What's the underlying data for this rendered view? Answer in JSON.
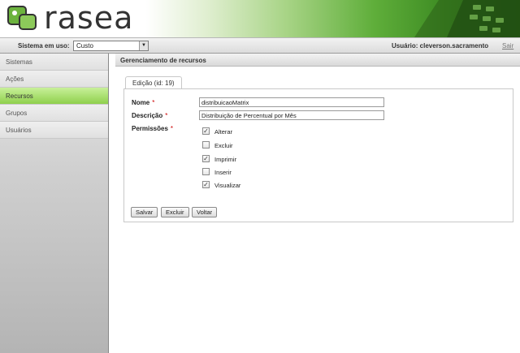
{
  "header": {
    "brand": "rasea"
  },
  "topbar": {
    "system_label": "Sistema em uso:",
    "system_value": "Custo",
    "user_label": "Usuário: cleverson.sacramento",
    "logout_label": "Sair"
  },
  "sidebar": {
    "items": [
      {
        "label": "Sistemas"
      },
      {
        "label": "Ações"
      },
      {
        "label": "Recursos"
      },
      {
        "label": "Grupos"
      },
      {
        "label": "Usuários"
      }
    ]
  },
  "main": {
    "title": "Gerenciamento de recursos",
    "tab_label": "Edição (id: 19)",
    "form": {
      "nome_label": "Nome",
      "nome_value": "distribuicaoMatrix",
      "descricao_label": "Descrição",
      "descricao_value": "Distribuição de Percentual por Mês",
      "permissoes_label": "Permissões",
      "required_mark": "*",
      "permissions": [
        {
          "label": "Alterar",
          "checked": true
        },
        {
          "label": "Excluir",
          "checked": false
        },
        {
          "label": "Imprimir",
          "checked": true
        },
        {
          "label": "Inserir",
          "checked": false
        },
        {
          "label": "Visualizar",
          "checked": true
        }
      ]
    },
    "buttons": {
      "save": "Salvar",
      "delete": "Excluir",
      "back": "Voltar"
    }
  },
  "colors": {
    "active_menu": "#8fd04c",
    "required": "#cc0000",
    "brand_green": "#5fae3a"
  }
}
